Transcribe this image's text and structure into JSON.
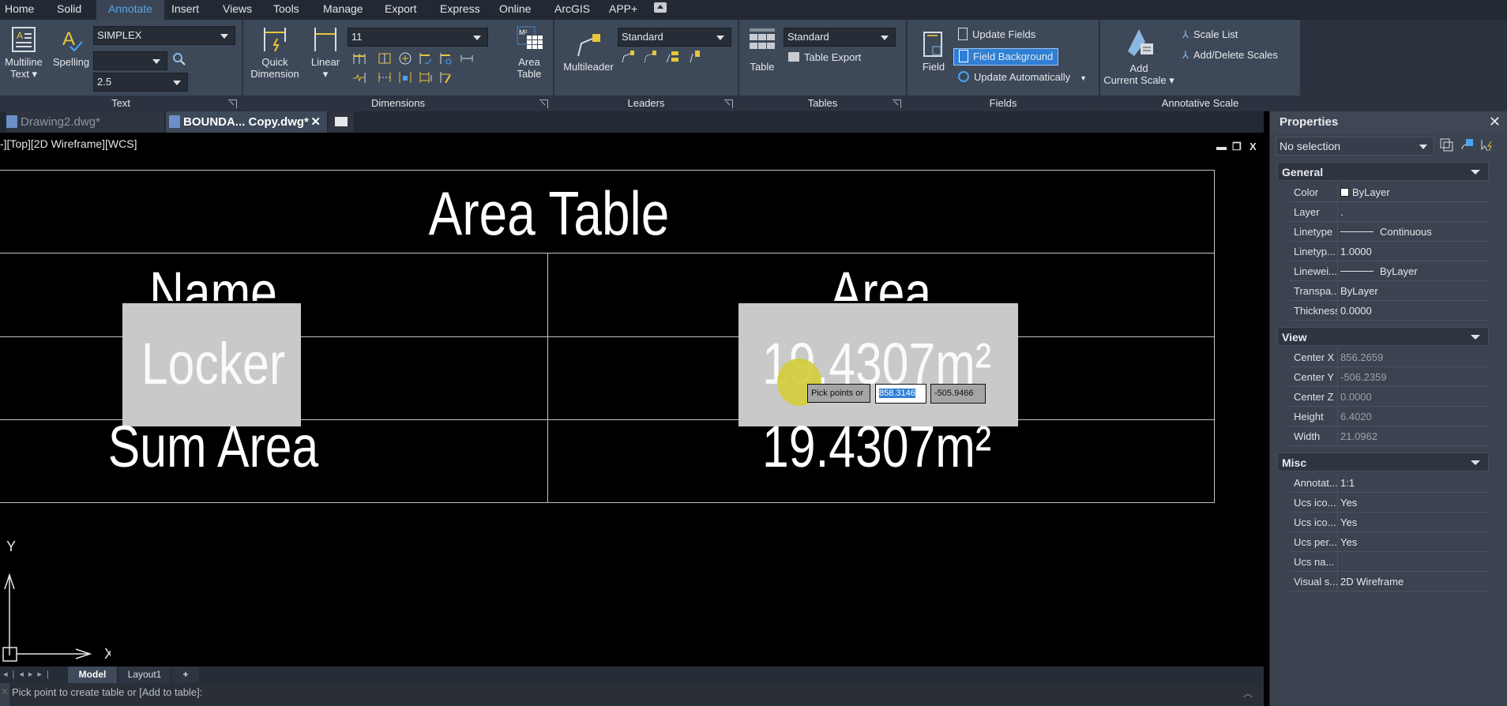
{
  "menu": {
    "tabs": [
      "Home",
      "Solid",
      "Annotate",
      "Insert",
      "Views",
      "Tools",
      "Manage",
      "Export",
      "Express",
      "Online",
      "ArcGIS",
      "APP+"
    ],
    "active": "Annotate"
  },
  "ribbon": {
    "text_panel": {
      "title": "Text",
      "multiline_text": "Multiline",
      "multiline_text2": "Text ▾",
      "spelling": "Spelling",
      "font_combo": "SIMPLEX",
      "find_field": "",
      "height_combo": "2.5"
    },
    "dimensions_panel": {
      "title": "Dimensions",
      "quick_dimension": "Quick",
      "quick_dimension2": "Dimension",
      "linear": "Linear",
      "linear2": "▾",
      "dimstyle_combo": "11",
      "area_table": "Area",
      "area_table2": "Table"
    },
    "leaders_panel": {
      "title": "Leaders",
      "multileader": "Multileader",
      "style_combo": "Standard"
    },
    "tables_panel": {
      "title": "Tables",
      "table": "Table",
      "style_combo": "Standard",
      "table_export": "Table Export"
    },
    "fields_panel": {
      "title": "Fields",
      "field": "Field",
      "update_fields": "Update Fields",
      "field_background": "Field Background",
      "update_automatically": "Update Automatically"
    },
    "annotative_panel": {
      "title": "Annotative Scale",
      "add_current_scale": "Add",
      "add_current_scale2": "Current Scale ▾",
      "scale_list": "Scale List",
      "add_delete_scales": "Add/Delete Scales"
    }
  },
  "doc_tabs": [
    {
      "label": "Drawing2.dwg*",
      "active": false
    },
    {
      "label": "BOUNDA... Copy.dwg*",
      "active": true
    }
  ],
  "viewport": {
    "label": "-][Top][2D Wireframe][WCS]",
    "min": "▬",
    "restore": "❐",
    "close": "X"
  },
  "drawing_table": {
    "title": "Area Table",
    "headers": [
      "Name",
      "Area"
    ],
    "rows": [
      [
        "Locker",
        "19.4307m²"
      ],
      [
        "Sum Area",
        "19.4307m²"
      ]
    ]
  },
  "dynamic_input": {
    "prompt": "Pick points or",
    "x_value": "858.3146",
    "y_value": "-505.9466"
  },
  "ucs": {
    "x": "X",
    "y": "Y"
  },
  "layout_tabs": [
    "Model",
    "Layout1",
    "+"
  ],
  "active_layout": "Model",
  "command_line": {
    "text": "Pick point to create table or [Add to table]:"
  },
  "properties": {
    "title": "Properties",
    "selection": "No selection",
    "sections": [
      {
        "name": "General",
        "rows": [
          {
            "key": "Color",
            "value": "ByLayer",
            "swatch": "#ffffff"
          },
          {
            "key": "Layer",
            "value": "."
          },
          {
            "key": "Linetype",
            "value": "Continuous",
            "line": true
          },
          {
            "key": "Linetyp...",
            "value": "1.0000"
          },
          {
            "key": "Linewei...",
            "value": "ByLayer",
            "line": true
          },
          {
            "key": "Transpa...",
            "value": "ByLayer"
          },
          {
            "key": "Thickness",
            "value": "0.0000"
          }
        ]
      },
      {
        "name": "View",
        "rows": [
          {
            "key": "Center X",
            "value": "856.2659",
            "dim": true
          },
          {
            "key": "Center Y",
            "value": "-506.2359",
            "dim": true
          },
          {
            "key": "Center Z",
            "value": "0.0000",
            "dim": true
          },
          {
            "key": "Height",
            "value": "6.4020",
            "dim": true
          },
          {
            "key": "Width",
            "value": "21.0962",
            "dim": true
          }
        ]
      },
      {
        "name": "Misc",
        "rows": [
          {
            "key": "Annotat...",
            "value": "1:1"
          },
          {
            "key": "Ucs ico...",
            "value": "Yes"
          },
          {
            "key": "Ucs ico...",
            "value": "Yes"
          },
          {
            "key": "Ucs per...",
            "value": "Yes"
          },
          {
            "key": "Ucs na...",
            "value": ""
          },
          {
            "key": "Visual s...",
            "value": "2D Wireframe"
          }
        ]
      }
    ]
  },
  "colors": {
    "accent": "#5ba4e6",
    "highlight": "#2f7fd6",
    "cursor": "#d4cc3c",
    "field_bg": "#c9c9c9"
  }
}
